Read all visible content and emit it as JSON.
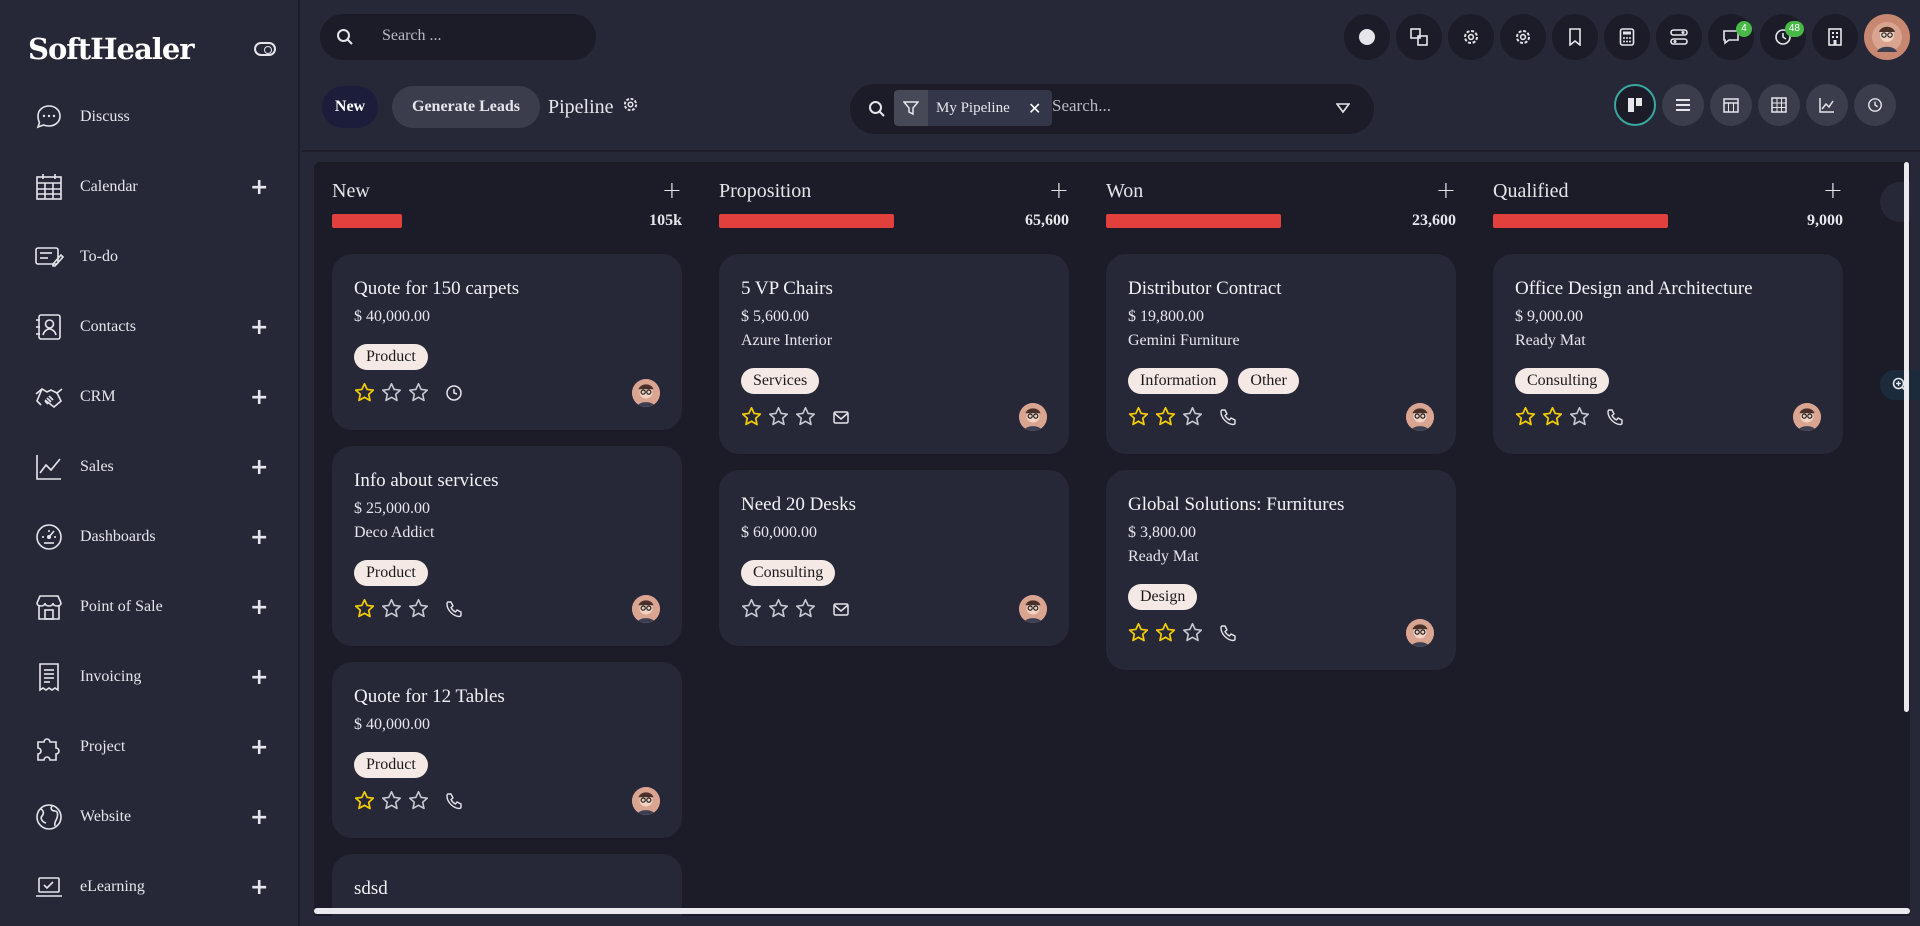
{
  "app": {
    "logo": "SoftHealer"
  },
  "sidebar": {
    "items": [
      {
        "label": "Discuss",
        "icon": "chat-icon",
        "expandable": false
      },
      {
        "label": "Calendar",
        "icon": "calendar-icon",
        "expandable": true
      },
      {
        "label": "To-do",
        "icon": "todo-icon",
        "expandable": false
      },
      {
        "label": "Contacts",
        "icon": "contacts-icon",
        "expandable": true
      },
      {
        "label": "CRM",
        "icon": "handshake-icon",
        "expandable": true
      },
      {
        "label": "Sales",
        "icon": "chart-line-icon",
        "expandable": true
      },
      {
        "label": "Dashboards",
        "icon": "gauge-icon",
        "expandable": true
      },
      {
        "label": "Point of Sale",
        "icon": "store-icon",
        "expandable": true
      },
      {
        "label": "Invoicing",
        "icon": "receipt-icon",
        "expandable": true
      },
      {
        "label": "Project",
        "icon": "puzzle-icon",
        "expandable": true
      },
      {
        "label": "Website",
        "icon": "globe-icon",
        "expandable": true
      },
      {
        "label": "eLearning",
        "icon": "laptop-icon",
        "expandable": true
      }
    ],
    "plus": "+"
  },
  "topbar": {
    "search_placeholder": "Search ...",
    "badges": {
      "messages": "4",
      "activities": "48"
    }
  },
  "control": {
    "new_label": "New",
    "generate_label": "Generate Leads",
    "pipeline_title": "Pipeline",
    "facet_value": "My Pipeline",
    "search_placeholder": "Search..."
  },
  "columns": [
    {
      "title": "New",
      "total": "105k",
      "progress": 0.2,
      "cards": [
        {
          "name": "Quote for 150 carpets",
          "amount": "$ 40,000.00",
          "partner": "",
          "tags": [
            "Product"
          ],
          "stars": 1,
          "activity": "clock-icon"
        },
        {
          "name": "Info about services",
          "amount": "$ 25,000.00",
          "partner": "Deco Addict",
          "tags": [
            "Product"
          ],
          "stars": 1,
          "activity": "phone-icon"
        },
        {
          "name": "Quote for 12 Tables",
          "amount": "$ 40,000.00",
          "partner": "",
          "tags": [
            "Product"
          ],
          "stars": 1,
          "activity": "phone-icon"
        },
        {
          "name": "sdsd",
          "amount": "",
          "partner": "",
          "tags": [],
          "stars": 0,
          "activity": ""
        }
      ]
    },
    {
      "title": "Proposition",
      "total": "65,600",
      "progress": 0.5,
      "cards": [
        {
          "name": "5 VP Chairs",
          "amount": "$ 5,600.00",
          "partner": "Azure Interior",
          "tags": [
            "Services"
          ],
          "stars": 1,
          "activity": "mail-icon"
        },
        {
          "name": "Need 20 Desks",
          "amount": "$ 60,000.00",
          "partner": "",
          "tags": [
            "Consulting"
          ],
          "stars": 0,
          "activity": "mail-icon"
        }
      ]
    },
    {
      "title": "Won",
      "total": "23,600",
      "progress": 0.5,
      "cards": [
        {
          "name": "Distributor Contract",
          "amount": "$ 19,800.00",
          "partner": "Gemini Furniture",
          "tags": [
            "Information",
            "Other"
          ],
          "stars": 2,
          "activity": "phone-icon"
        },
        {
          "name": "Global Solutions: Furnitures",
          "amount": "$ 3,800.00",
          "partner": "Ready Mat",
          "tags": [
            "Design"
          ],
          "stars": 2,
          "activity": "phone-icon"
        }
      ]
    },
    {
      "title": "Qualified",
      "total": "9,000",
      "progress": 0.5,
      "cards": [
        {
          "name": "Office Design and Architecture",
          "amount": "$ 9,000.00",
          "partner": "Ready Mat",
          "tags": [
            "Consulting"
          ],
          "stars": 2,
          "activity": "phone-icon"
        }
      ]
    }
  ],
  "colors": {
    "accent": "#e2403d",
    "star": "#f3cc00",
    "tag_bg": "#f5e9e6",
    "badge": "#48b847"
  }
}
